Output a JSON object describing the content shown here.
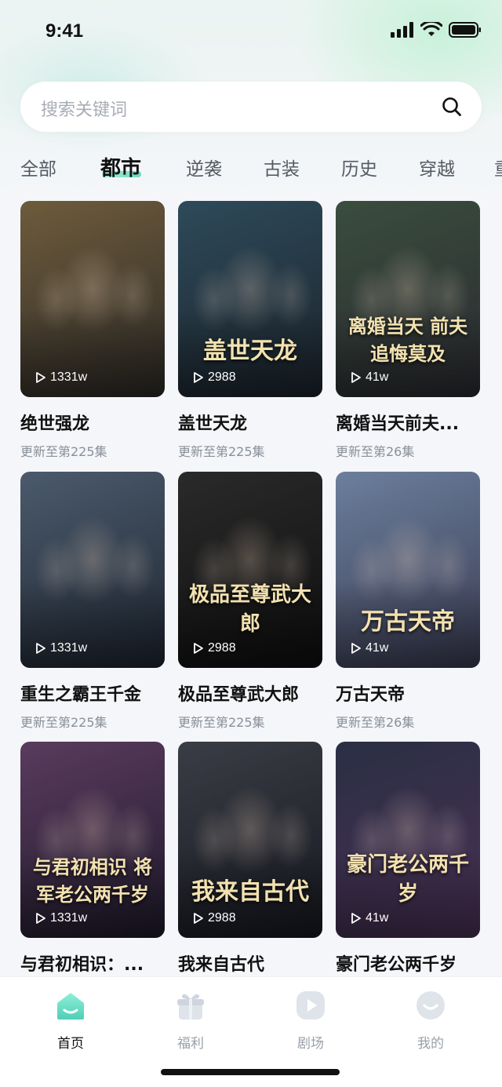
{
  "status": {
    "time": "9:41"
  },
  "search": {
    "placeholder": "搜索关键词"
  },
  "tabs": [
    "全部",
    "都市",
    "逆袭",
    "古装",
    "历史",
    "穿越",
    "重"
  ],
  "active_tab": "都市",
  "cards": [
    {
      "title": "绝世强龙",
      "subtitle": "更新至第225集",
      "plays": "1331w",
      "poster_text": "",
      "colors": [
        "#6e5b3c",
        "#2c2a26"
      ]
    },
    {
      "title": "盖世天龙",
      "subtitle": "更新至第225集",
      "plays": "2988",
      "poster_text": "盖世天龙",
      "colors": [
        "#2e4a5a",
        "#1b232b"
      ]
    },
    {
      "title": "离婚当天前夫...",
      "subtitle": "更新至第26集",
      "plays": "41w",
      "poster_text": "离婚当天 前夫追悔莫及",
      "colors": [
        "#3a4d3e",
        "#2a2a30"
      ]
    },
    {
      "title": "重生之霸王千金",
      "subtitle": "更新至第225集",
      "plays": "1331w",
      "poster_text": "",
      "colors": [
        "#4b5a6c",
        "#1e2631"
      ]
    },
    {
      "title": "极品至尊武大郎",
      "subtitle": "更新至第225集",
      "plays": "2988",
      "poster_text": "极品至尊武大郎",
      "colors": [
        "#2a2a2a",
        "#0e0e0e"
      ]
    },
    {
      "title": "万古天帝",
      "subtitle": "更新至第26集",
      "plays": "41w",
      "poster_text": "万古天帝",
      "colors": [
        "#6b7f9c",
        "#3a3b52"
      ]
    },
    {
      "title": "与君初相识：...",
      "subtitle": "",
      "plays": "1331w",
      "poster_text": "与君初相识 将军老公两千岁",
      "colors": [
        "#5a3b5e",
        "#1f1a2b"
      ]
    },
    {
      "title": "我来自古代",
      "subtitle": "",
      "plays": "2988",
      "poster_text": "我来自古代",
      "colors": [
        "#3a3d45",
        "#161820"
      ]
    },
    {
      "title": "豪门老公两千岁",
      "subtitle": "",
      "plays": "41w",
      "poster_text": "豪门老公两千岁",
      "colors": [
        "#2a2f44",
        "#4a3054"
      ]
    }
  ],
  "nav": [
    {
      "label": "首页",
      "icon": "home-icon",
      "active": true
    },
    {
      "label": "福利",
      "icon": "gift-icon",
      "active": false
    },
    {
      "label": "剧场",
      "icon": "play-icon",
      "active": false
    },
    {
      "label": "我的",
      "icon": "profile-icon",
      "active": false
    }
  ],
  "colors": {
    "accent": "#6bd7c0",
    "background": "#f4f6f9",
    "text": "#111111",
    "muted": "#8a9099"
  }
}
